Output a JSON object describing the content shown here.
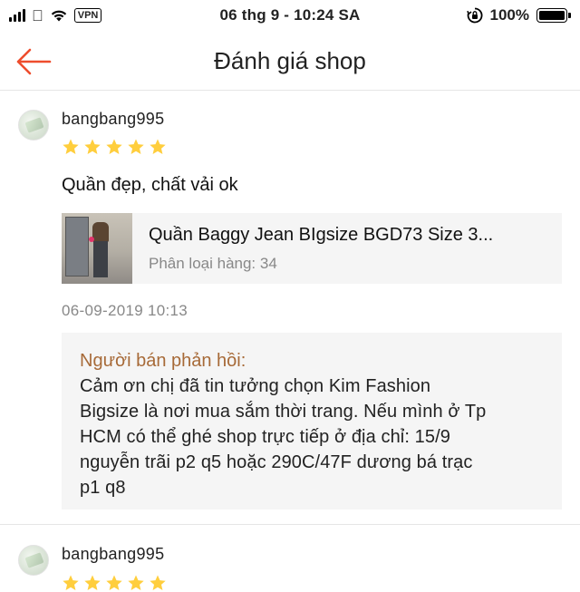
{
  "status_bar": {
    "vpn": "VPN",
    "time": "06 thg 9 - 10:24 SA",
    "battery": "100%",
    "battery_level": 1.0
  },
  "header": {
    "title": "Đánh giá shop",
    "back_icon": "back-arrow-icon",
    "accent_color": "#ee4d2d"
  },
  "reviews": [
    {
      "username": "bangbang995",
      "rating": 5,
      "star_color": "#ffce3d",
      "comment": "Quần đẹp, chất vải ok",
      "product": {
        "name": "Quần Baggy Jean BIgsize BGD73 Size 3...",
        "variant": "Phân loại hàng: 34"
      },
      "date": "06-09-2019 10:13",
      "seller_reply": {
        "title": "Người bán phản hồi:",
        "lines": [
          "Cảm ơn chị đã tin tưởng chọn Kim Fashion",
          "Bigsize là nơi mua sắm thời trang. Nếu mình ở Tp",
          "HCM có thể ghé shop trực tiếp ở địa chỉ: 15/9",
          "nguyễn trãi p2 q5 hoặc 290C/47F dương bá trạc",
          "p1 q8"
        ]
      }
    },
    {
      "username": "bangbang995",
      "rating": 5
    }
  ]
}
